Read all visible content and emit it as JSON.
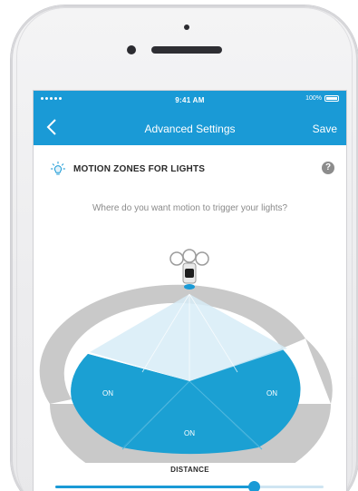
{
  "status_bar": {
    "time": "9:41 AM",
    "battery": "100%"
  },
  "nav": {
    "back_icon": "chevron-left-icon",
    "title": "Advanced Settings",
    "save_label": "Save"
  },
  "section": {
    "icon": "light-bulb-icon",
    "title": "MOTION ZONES FOR LIGHTS",
    "help_icon": "question-mark-icon",
    "help_label": "?"
  },
  "question": "Where do you want motion to trigger your lights?",
  "zones": [
    {
      "label": "ON",
      "state": "on"
    },
    {
      "label": "ON",
      "state": "on"
    },
    {
      "label": "ON",
      "state": "on"
    }
  ],
  "distance": {
    "label": "DISTANCE",
    "level_fraction": 0.74
  },
  "colors": {
    "accent": "#1a9ad6",
    "zone_on": "#1ba0d3",
    "zone_outer": "#c9c9c9",
    "coverage": "#d7ecf7"
  }
}
